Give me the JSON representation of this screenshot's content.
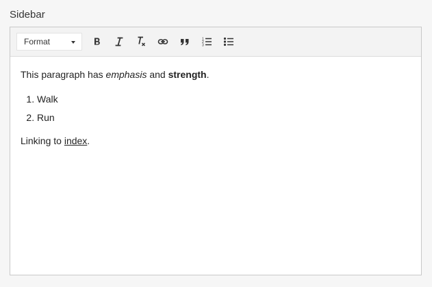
{
  "field": {
    "label": "Sidebar"
  },
  "toolbar": {
    "format_label": "Format",
    "buttons": [
      {
        "name": "bold-icon"
      },
      {
        "name": "italic-icon"
      },
      {
        "name": "clear-format-icon"
      },
      {
        "name": "link-icon"
      },
      {
        "name": "blockquote-icon"
      },
      {
        "name": "numbered-list-icon"
      },
      {
        "name": "bulleted-list-icon"
      }
    ]
  },
  "content": {
    "p1_before": "This paragraph has ",
    "p1_em": "emphasis",
    "p1_mid": " and ",
    "p1_strong": "strength",
    "p1_end": ".",
    "list": [
      "Walk",
      "Run"
    ],
    "p2_before": "Linking to ",
    "p2_link": "index",
    "p2_end": "."
  }
}
